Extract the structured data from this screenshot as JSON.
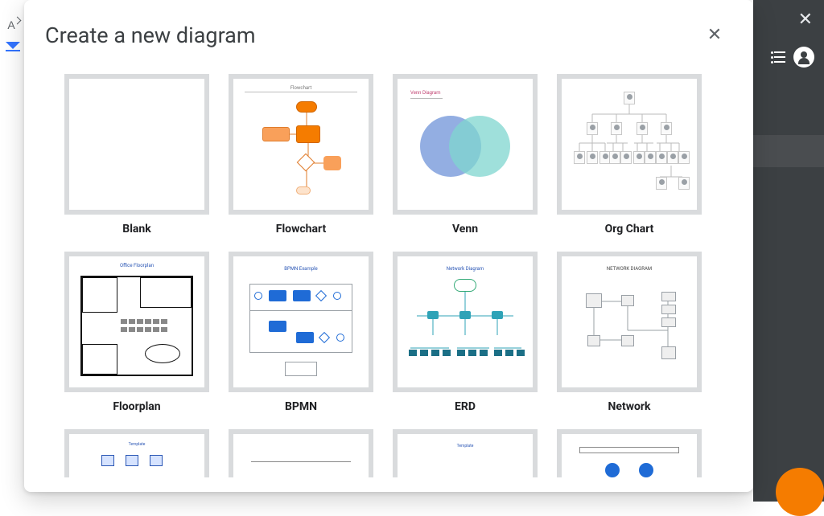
{
  "modal": {
    "title": "Create a new diagram",
    "templates": [
      {
        "label": "Blank"
      },
      {
        "label": "Flowchart"
      },
      {
        "label": "Venn"
      },
      {
        "label": "Org Chart"
      },
      {
        "label": "Floorplan"
      },
      {
        "label": "BPMN"
      },
      {
        "label": "ERD"
      },
      {
        "label": "Network"
      }
    ]
  }
}
